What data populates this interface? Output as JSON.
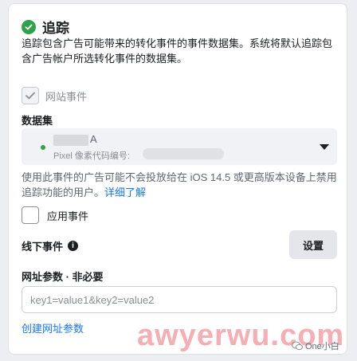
{
  "section": {
    "title": "追踪",
    "description": "追踪包含广告可能带来的转化事件的事件数据集。系统将默认追踪包含广告帐户所选转化事件的数据集。"
  },
  "website_events": {
    "label": "网站事件",
    "checked": true,
    "disabled": true
  },
  "dataset": {
    "label": "数据集",
    "name_suffix": "A",
    "pixel_label": "Pixel 像素代码编号:",
    "status_color": "#31a24c"
  },
  "warning": {
    "text": "使用此事件的广告可能不会投放给在 iOS 14.5 或更高版本设备上禁用追踪功能的用户。",
    "link": "详细了解"
  },
  "app_events": {
    "label": "应用事件",
    "checked": false
  },
  "offline_events": {
    "label": "线下事件",
    "settings_button": "设置"
  },
  "url_params": {
    "label": "网址参数 · 非必要",
    "placeholder": "key1=value1&key2=value2",
    "create_link": "创建网址参数"
  },
  "watermark": {
    "text": "awyerwu.com",
    "badge": "One小白"
  },
  "colors": {
    "accent": "#1877f2",
    "success": "#31a24c",
    "watermark": "#f3a0a7"
  }
}
